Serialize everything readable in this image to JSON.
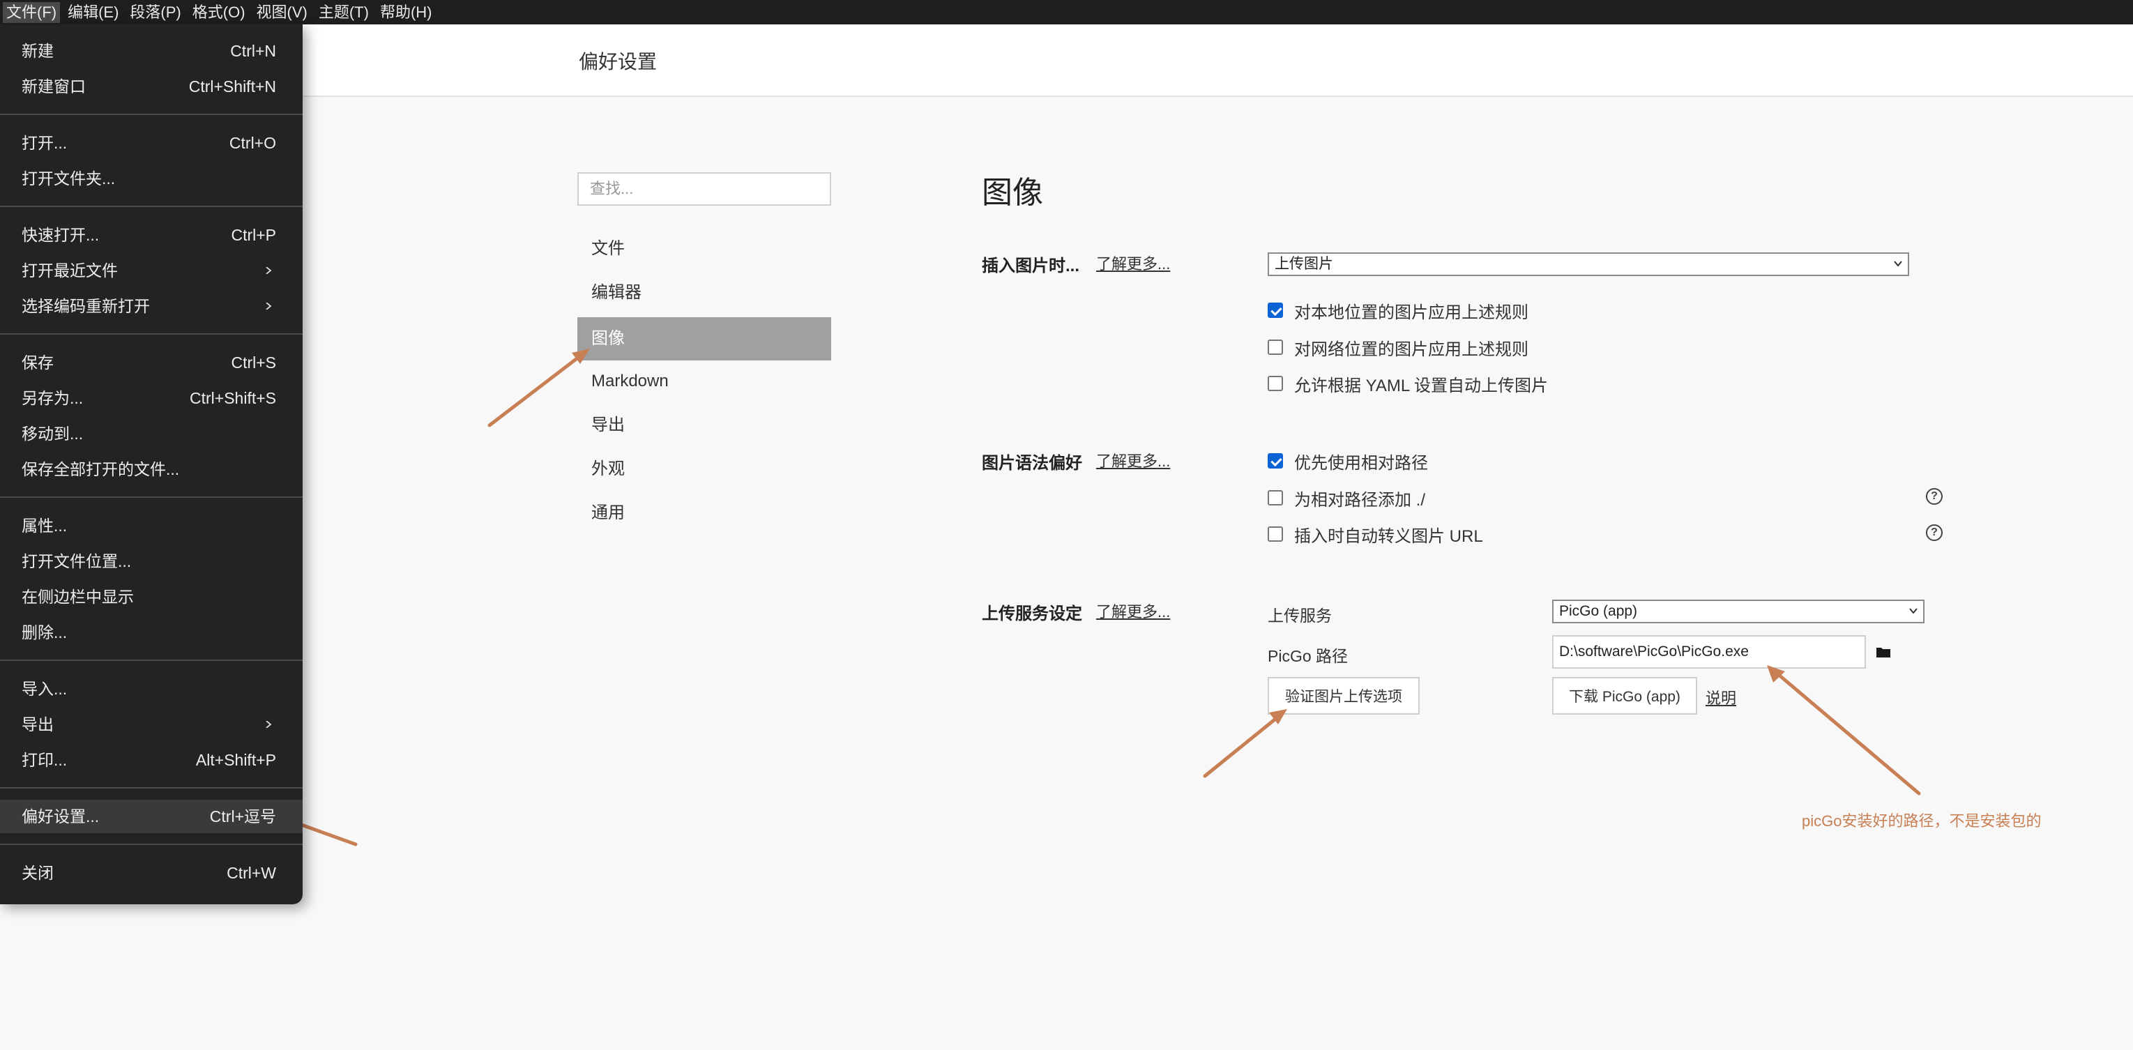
{
  "menubar": [
    {
      "label": "文件(F)"
    },
    {
      "label": "编辑(E)"
    },
    {
      "label": "段落(P)"
    },
    {
      "label": "格式(O)"
    },
    {
      "label": "视图(V)"
    },
    {
      "label": "主题(T)"
    },
    {
      "label": "帮助(H)"
    }
  ],
  "header": {
    "title": "偏好设置"
  },
  "nav": {
    "search_placeholder": "查找...",
    "items": [
      {
        "label": "文件"
      },
      {
        "label": "编辑器"
      },
      {
        "label": "图像",
        "selected": true
      },
      {
        "label": "Markdown"
      },
      {
        "label": "导出"
      },
      {
        "label": "外观"
      },
      {
        "label": "通用"
      }
    ]
  },
  "content": {
    "section_title": "图像",
    "insert": {
      "label": "插入图片时...",
      "learn_more": "了解更多...",
      "select_value": "上传图片",
      "options": [
        {
          "label": "对本地位置的图片应用上述规则",
          "checked": true
        },
        {
          "label": "对网络位置的图片应用上述规则",
          "checked": false
        },
        {
          "label": "允许根据 YAML 设置自动上传图片",
          "checked": false
        }
      ]
    },
    "syntax": {
      "label": "图片语法偏好",
      "learn_more": "了解更多...",
      "options": [
        {
          "label": "优先使用相对路径",
          "checked": true
        },
        {
          "label": "为相对路径添加 ./",
          "checked": false,
          "help_icon": "question-circle-icon"
        },
        {
          "label": "插入时自动转义图片 URL",
          "checked": false,
          "help_icon": "question-circle-icon"
        }
      ]
    },
    "upload": {
      "label": "上传服务设定",
      "learn_more": "了解更多...",
      "service_label": "上传服务",
      "service_value": "PicGo (app)",
      "path_label": "PicGo 路径",
      "path_value": "D:\\software\\PicGo\\PicGo.exe",
      "verify_button": "验证图片上传选项",
      "download_button": "下载 PicGo (app)",
      "readme_link": "说明",
      "folder_icon": "folder-icon"
    }
  },
  "file_menu": {
    "groups": [
      [
        {
          "label": "新建",
          "shortcut": "Ctrl+N"
        },
        {
          "label": "新建窗口",
          "shortcut": "Ctrl+Shift+N"
        }
      ],
      [
        {
          "label": "打开...",
          "shortcut": "Ctrl+O"
        },
        {
          "label": "打开文件夹...",
          "shortcut": ""
        }
      ],
      [
        {
          "label": "快速打开...",
          "shortcut": "Ctrl+P"
        },
        {
          "label": "打开最近文件",
          "shortcut": "",
          "submenu": true
        },
        {
          "label": "选择编码重新打开",
          "shortcut": "",
          "submenu": true
        }
      ],
      [
        {
          "label": "保存",
          "shortcut": "Ctrl+S"
        },
        {
          "label": "另存为...",
          "shortcut": "Ctrl+Shift+S"
        },
        {
          "label": "移动到...",
          "shortcut": ""
        },
        {
          "label": "保存全部打开的文件...",
          "shortcut": ""
        }
      ],
      [
        {
          "label": "属性...",
          "shortcut": ""
        },
        {
          "label": "打开文件位置...",
          "shortcut": ""
        },
        {
          "label": "在侧边栏中显示",
          "shortcut": ""
        },
        {
          "label": "删除...",
          "shortcut": ""
        }
      ],
      [
        {
          "label": "导入...",
          "shortcut": ""
        },
        {
          "label": "导出",
          "shortcut": "",
          "submenu": true
        },
        {
          "label": "打印...",
          "shortcut": "Alt+Shift+P"
        }
      ],
      [
        {
          "label": "偏好设置...",
          "shortcut": "Ctrl+逗号",
          "hover": true
        }
      ],
      [
        {
          "label": "关闭",
          "shortcut": "Ctrl+W"
        }
      ]
    ]
  },
  "annotation": {
    "text": "picGo安装好的路径，不是安装包的",
    "color": "#c87f54"
  },
  "colors": {
    "menu_bg": "#232323",
    "selected_nav": "#a0a0a0",
    "checkbox_checked": "#0b63d6"
  }
}
